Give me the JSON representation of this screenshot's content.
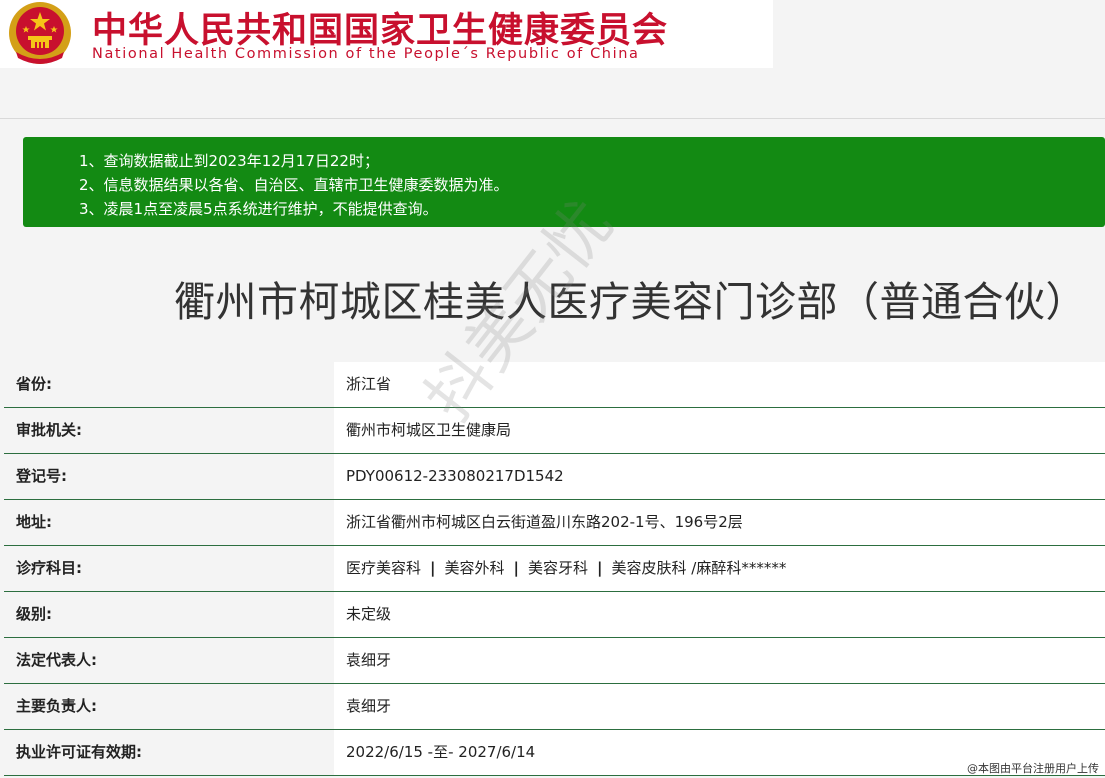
{
  "header": {
    "title_cn": "中华人民共和国国家卫生健康委员会",
    "title_en": "National Health Commission of the People´s Republic of China",
    "emblem_icon": "national-emblem-icon",
    "colors": {
      "brand_red": "#c8102e",
      "notice_green": "#138a13"
    }
  },
  "notice": {
    "lines": [
      "1、查询数据截止到2023年12月17日22时；",
      "2、信息数据结果以各省、自治区、直辖市卫生健康委数据为准。",
      "3、凌晨1点至凌晨5点系统进行维护，不能提供查询。"
    ]
  },
  "page_title": "衢州市柯城区桂美人医疗美容门诊部（普通合伙）",
  "rows": [
    {
      "label": "省份:",
      "value": "浙江省"
    },
    {
      "label": "审批机关:",
      "value": "衢州市柯城区卫生健康局"
    },
    {
      "label": "登记号:",
      "value": "PDY00612-233080217D1542"
    },
    {
      "label": "地址:",
      "value": "浙江省衢州市柯城区白云街道盈川东路202-1号、196号2层"
    },
    {
      "label": "诊疗科目:",
      "departments": [
        "医疗美容科",
        "美容外科",
        "美容牙科",
        "美容皮肤科 /麻醉科******"
      ],
      "separator": "|"
    },
    {
      "label": "级别:",
      "value": "未定级"
    },
    {
      "label": "法定代表人:",
      "value": "袁细牙"
    },
    {
      "label": "主要负责人:",
      "value": "袁细牙"
    },
    {
      "label": "执业许可证有效期:",
      "value": "2022/6/15 -至- 2027/6/14"
    }
  ],
  "watermark": "抖美无忧",
  "footer_note": "@本图由平台注册用户上传"
}
